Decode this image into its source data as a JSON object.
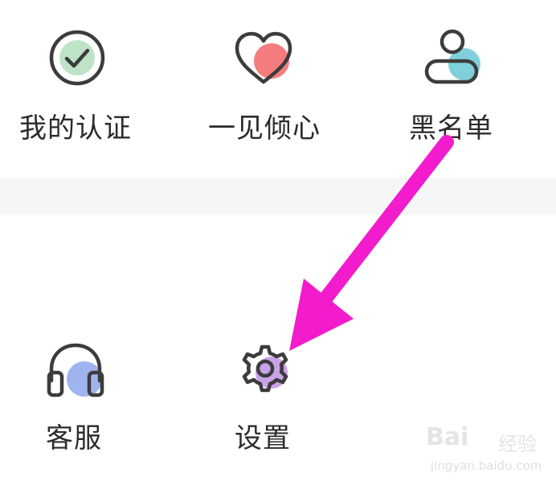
{
  "menu": {
    "row1": [
      {
        "label": "我的认证",
        "icon": "verified-check-icon"
      },
      {
        "label": "一见倾心",
        "icon": "heart-icon"
      },
      {
        "label": "黑名单",
        "icon": "blacklist-user-icon"
      }
    ],
    "row2": [
      {
        "label": "客服",
        "icon": "headphones-icon"
      },
      {
        "label": "设置",
        "icon": "gear-icon"
      }
    ]
  },
  "colors": {
    "icon_stroke": "#3c3c3c",
    "check_fill": "#bfe3c6",
    "heart_fill": "#f47c7c",
    "user_fill": "#7fd0da",
    "headphone_fill": "#9fb4ef",
    "gear_fill": "#c9a3e8",
    "annotation_arrow": "#f21ccc",
    "divider": "#f6f6f6"
  },
  "watermark": {
    "brand": "Bai",
    "sub": "经验",
    "url": "jingyan.baidu.com"
  }
}
